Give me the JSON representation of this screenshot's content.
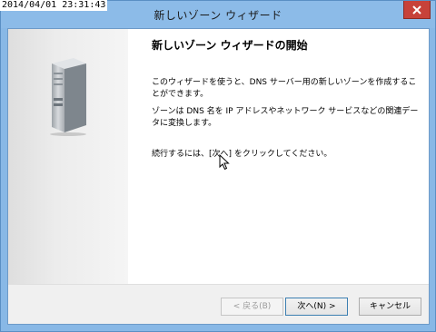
{
  "timestamp": "2014/04/01 23:31:43",
  "window": {
    "title": "新しいゾーン ウィザード"
  },
  "content": {
    "heading": "新しいゾーン ウィザードの開始",
    "paragraph1": "このウィザードを使うと、DNS サーバー用の新しいゾーンを作成することができます。",
    "paragraph2": "ゾーンは DNS 名を IP アドレスやネットワーク サービスなどの関連データに変換します。",
    "paragraph3": "続行するには、[次へ] をクリックしてください。"
  },
  "buttons": {
    "back": "< 戻る(B)",
    "next": "次へ(N) >",
    "cancel": "キャンセル"
  },
  "colors": {
    "titlebar": "#8cbbe8",
    "close": "#c7423a",
    "footer": "#f0f0f0"
  },
  "icons": {
    "side": "server-icon",
    "close": "close-icon",
    "pointer": "mouse-cursor"
  }
}
